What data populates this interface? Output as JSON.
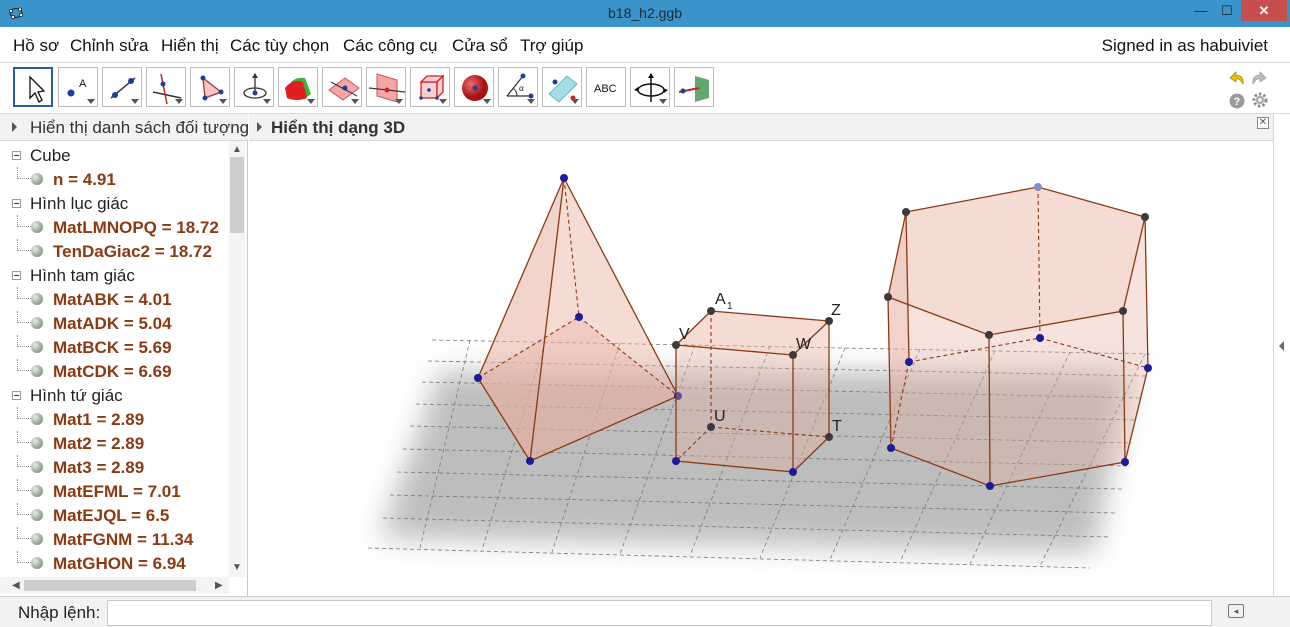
{
  "window": {
    "title": "b18_h2.ggb"
  },
  "menu": {
    "items": [
      "Hồ sơ",
      "Chỉnh sửa",
      "Hiển thị",
      "Các tùy chọn",
      "Các công cụ",
      "Cửa sổ",
      "Trợ giúp"
    ],
    "signed_in": "Signed in as habuiviet"
  },
  "toolbar": {
    "tools": [
      {
        "icon": "move-cursor-icon"
      },
      {
        "icon": "point-icon"
      },
      {
        "icon": "line-icon"
      },
      {
        "icon": "perpendicular-line-icon"
      },
      {
        "icon": "polygon-icon"
      },
      {
        "icon": "circle-axis-icon"
      },
      {
        "icon": "intersect-surfaces-icon"
      },
      {
        "icon": "plane-icon"
      },
      {
        "icon": "perpendicular-plane-icon"
      },
      {
        "icon": "pyramid-icon"
      },
      {
        "icon": "sphere-icon"
      },
      {
        "icon": "angle-icon"
      },
      {
        "icon": "reflect-icon"
      },
      {
        "icon": "text-icon",
        "label": "ABC"
      },
      {
        "icon": "rotate-view-icon"
      },
      {
        "icon": "view-direction-icon"
      }
    ]
  },
  "algebra": {
    "header": "Hiển thị danh sách đối tượng",
    "groups": [
      {
        "name": "Cube",
        "items": [
          "n = 4.91"
        ]
      },
      {
        "name": "Hình lục giác",
        "items": [
          "MatLMNOPQ = 18.72",
          "TenDaGiac2 = 18.72"
        ]
      },
      {
        "name": "Hình tam giác",
        "items": [
          "MatABK = 4.01",
          "MatADK = 5.04",
          "MatBCK = 5.69",
          "MatCDK = 6.69"
        ]
      },
      {
        "name": "Hình tứ giác",
        "items": [
          "Mat1 = 2.89",
          "Mat2 = 2.89",
          "Mat3 = 2.89",
          "MatEFML = 7.01",
          "MatEJQL = 6.5",
          "MatFGNM = 11.34",
          "MatGHON = 6.94"
        ]
      }
    ]
  },
  "view3d": {
    "header": "Hiển thị dạng 3D",
    "labels": {
      "A1": "A",
      "A1_sub": "1",
      "Z": "Z",
      "V": "V",
      "W": "W",
      "U": "U",
      "T": "T"
    }
  },
  "input": {
    "label": "Nhập lệnh:",
    "value": ""
  },
  "colors": {
    "titlebar": "#3a93c9",
    "object_text": "#8b3a12",
    "face_fill": "#e8b9a8",
    "edge": "#8b3a12"
  }
}
